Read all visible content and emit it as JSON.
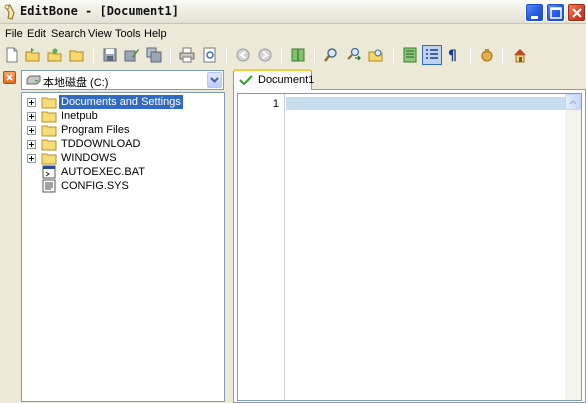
{
  "window": {
    "title": "EditBone - [Document1]",
    "buttons": {
      "minimize": "minimize",
      "maximize": "maximize",
      "close": "close"
    }
  },
  "menu": {
    "items": [
      {
        "label": "File"
      },
      {
        "label": "Edit"
      },
      {
        "label": "Search"
      },
      {
        "label": "View"
      },
      {
        "label": "Tools"
      },
      {
        "label": "Help"
      }
    ]
  },
  "toolbar": {
    "buttons": [
      {
        "icon": "new-file-icon"
      },
      {
        "icon": "open-file-icon"
      },
      {
        "icon": "open-recent-icon"
      },
      {
        "icon": "open-folder-icon"
      },
      {
        "icon": "save-icon"
      },
      {
        "icon": "save-as-icon"
      },
      {
        "icon": "save-all-icon"
      },
      {
        "icon": "print-icon"
      },
      {
        "icon": "print-preview-icon"
      },
      {
        "icon": "undo-icon"
      },
      {
        "icon": "redo-icon"
      },
      {
        "icon": "compare-icon"
      },
      {
        "icon": "search-icon"
      },
      {
        "icon": "replace-icon"
      },
      {
        "icon": "find-in-files-icon"
      },
      {
        "icon": "word-wrap-icon"
      },
      {
        "icon": "line-numbers-icon",
        "pressed": true
      },
      {
        "icon": "special-chars-icon"
      },
      {
        "icon": "macro-icon"
      },
      {
        "icon": "home-icon"
      }
    ]
  },
  "explorer": {
    "drive": "本地磁盘 (C:)",
    "tree": [
      {
        "label": "Documents and Settings",
        "type": "folder",
        "selected": true
      },
      {
        "label": "Inetpub",
        "type": "folder"
      },
      {
        "label": "Program Files",
        "type": "folder"
      },
      {
        "label": "TDDOWNLOAD",
        "type": "folder"
      },
      {
        "label": "WINDOWS",
        "type": "folder"
      },
      {
        "label": "AUTOEXEC.BAT",
        "type": "file"
      },
      {
        "label": "CONFIG.SYS",
        "type": "file"
      }
    ]
  },
  "editor": {
    "tab_label": "Document1",
    "line_number": "1"
  },
  "colors": {
    "selection": "#316ac5",
    "current_line": "#c8dcf0",
    "tab_accent": "#ffc83c",
    "window_bg": "#ece9d8"
  }
}
